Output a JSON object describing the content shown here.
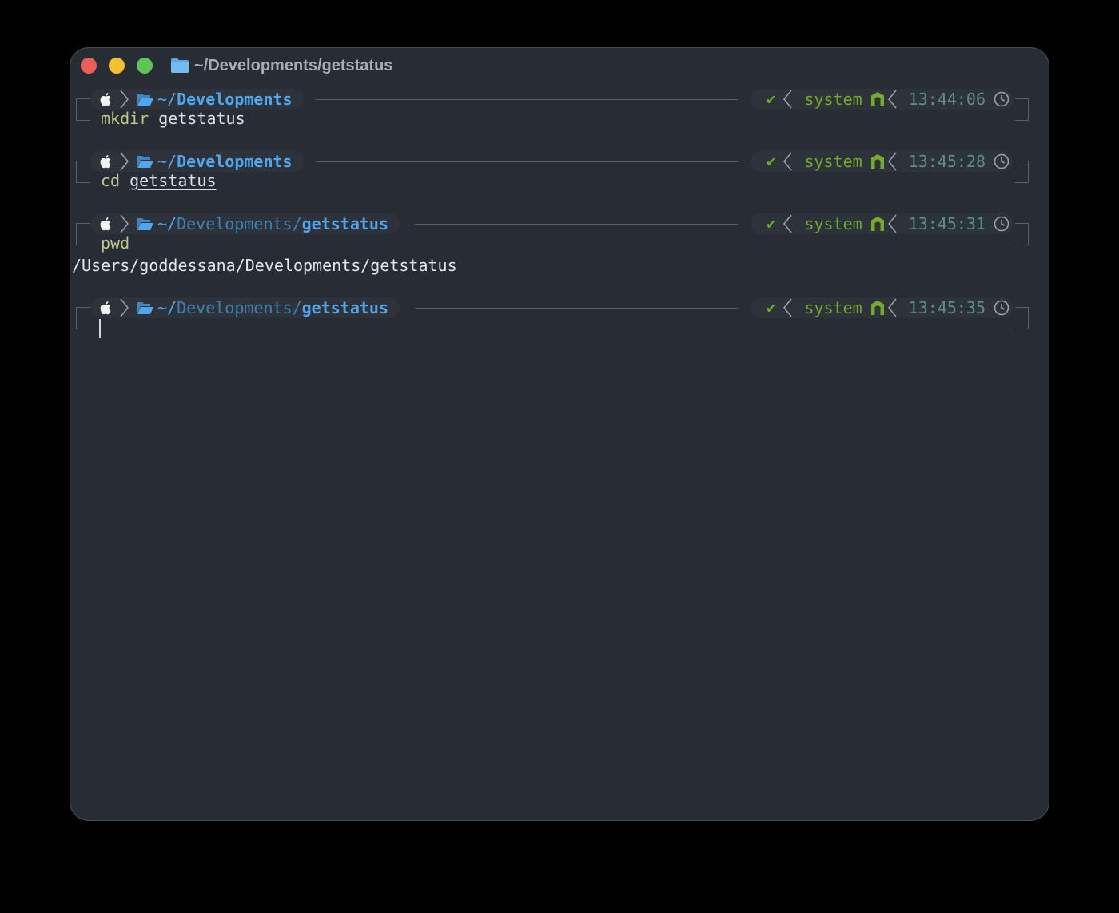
{
  "window": {
    "title": "~/Developments/getstatus"
  },
  "colors": {
    "path": "#4fa6ec",
    "ok": "#67b01f",
    "system": "#74ab2b",
    "time": "#5d8c8c",
    "command": "#c1c689"
  },
  "prompts": [
    {
      "path_prefix": "~/",
      "path_dim": "",
      "path_bold": "Developments",
      "check": "✔",
      "env": "system",
      "time": "13:44:06",
      "cmd_name": "mkdir",
      "cmd_arg": "getstatus"
    },
    {
      "path_prefix": "~/",
      "path_dim": "",
      "path_bold": "Developments",
      "check": "✔",
      "env": "system",
      "time": "13:45:28",
      "cmd_name": "cd",
      "cmd_arg": "getstatus"
    },
    {
      "path_prefix": "~/",
      "path_dim": "Developments/",
      "path_bold": "getstatus",
      "check": "✔",
      "env": "system",
      "time": "13:45:31",
      "cmd_name": "pwd",
      "cmd_arg": ""
    },
    {
      "path_prefix": "~/",
      "path_dim": "Developments/",
      "path_bold": "getstatus",
      "check": "✔",
      "env": "system",
      "time": "13:45:35",
      "cmd_name": "",
      "cmd_arg": ""
    }
  ],
  "outputs": {
    "pwd": "/Users/goddessana/Developments/getstatus"
  },
  "icons": [
    "apple-icon",
    "chevron-right-icon",
    "folder-open-icon",
    "check-icon",
    "chevron-left-icon",
    "node-icon",
    "clock-icon"
  ]
}
